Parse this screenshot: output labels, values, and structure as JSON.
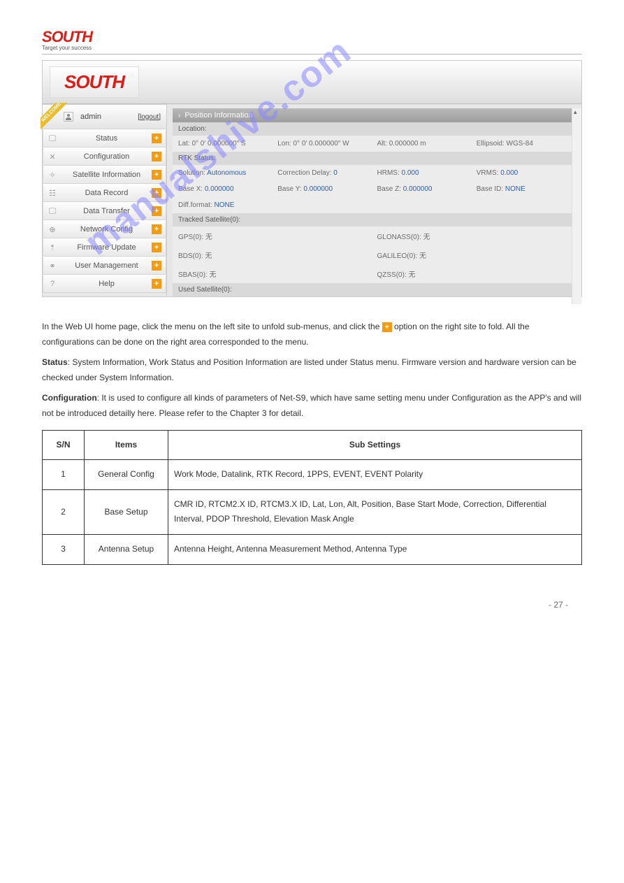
{
  "brand": {
    "name": "SOUTH",
    "tagline": "Target your success"
  },
  "app": {
    "logo": "SOUTH",
    "user": {
      "name": "admin",
      "logout": "[logout]",
      "welcome_ribbon": "WELCOME"
    },
    "menu": [
      {
        "icon": "🖵",
        "label": "Status"
      },
      {
        "icon": "✕",
        "label": "Configuration"
      },
      {
        "icon": "✧",
        "label": "Satellite Information"
      },
      {
        "icon": "☷",
        "label": "Data Record"
      },
      {
        "icon": "🖵",
        "label": "Data Transfer"
      },
      {
        "icon": "⊕",
        "label": "Network Config"
      },
      {
        "icon": "⇡",
        "label": "Firmware Update"
      },
      {
        "icon": "⚭",
        "label": "User Management"
      },
      {
        "icon": "?",
        "label": "Help"
      }
    ],
    "panel_title": "Position Information",
    "sections": {
      "location": {
        "head": "Location:",
        "lat": "Lat: 0° 0′ 0.000000″ S",
        "lon": "Lon: 0° 0′ 0.000000″ W",
        "alt": "Alt: 0.000000 m",
        "ellipsoid": "Ellipsoid: WGS-84"
      },
      "rtk": {
        "head": "RTK Status:",
        "solution_l": "Solution:",
        "solution_v": "Autonomous",
        "corr_l": "Correction Delay:",
        "corr_v": "0",
        "hrms_l": "HRMS:",
        "hrms_v": "0.000",
        "vrms_l": "VRMS:",
        "vrms_v": "0.000",
        "bx_l": "Base X:",
        "bx_v": "0.000000",
        "by_l": "Base Y:",
        "by_v": "0.000000",
        "bz_l": "Base Z:",
        "bz_v": "0.000000",
        "bid_l": "Base ID:",
        "bid_v": "NONE",
        "diff_l": "Diff.format:",
        "diff_v": "NONE"
      },
      "tracked": {
        "head": "Tracked Satellite(0):",
        "gps": "GPS(0): 无",
        "glonass": "GLONASS(0): 无",
        "bds": "BDS(0): 无",
        "galileo": "GALILEO(0): 无",
        "sbas": "SBAS(0): 无",
        "qzss": "QZSS(0): 无"
      },
      "used": {
        "head": "Used Satellite(0):"
      }
    }
  },
  "body": {
    "p1_pre": "In the Web UI home page, click the menu on the left site to unfold sub-menus, and click the ",
    "p1_mid": " option on the right site to fold. All the configurations can be done on the right area corresponded to the menu.",
    "p2_bold": "Status",
    "p2_rest": ": System Information, Work Status and Position Information are listed under Status menu. Firmware version and hardware version can be checked under ",
    "p2_sys": "System Information",
    "p3_bold": "Configuration",
    "p3_rest": ": It is used to configure all kinds of parameters of Net-S9, which have same setting menu under Configuration as the APP's and will not be introduced detailly here. Please refer to the Chapter 3 for detail."
  },
  "table": {
    "headers": [
      "S/N",
      "Items",
      "Sub Settings"
    ],
    "rows": [
      {
        "sn": "1",
        "item": "General Config",
        "sub": "Work Mode, Datalink, RTK Record, 1PPS, EVENT, EVENT Polarity"
      },
      {
        "sn": "2",
        "item": "Base Setup",
        "sub": "CMR ID, RTCM2.X ID, RTCM3.X ID, Lat, Lon, Alt, Position, Base Start Mode, Correction, Differential Interval, PDOP Threshold, Elevation Mask Angle"
      },
      {
        "sn": "3",
        "item": "Antenna Setup",
        "sub": "Antenna Height, Antenna Measurement Method, Antenna Type"
      }
    ]
  },
  "footer": "- 27 -",
  "watermark": "manualshive.com"
}
